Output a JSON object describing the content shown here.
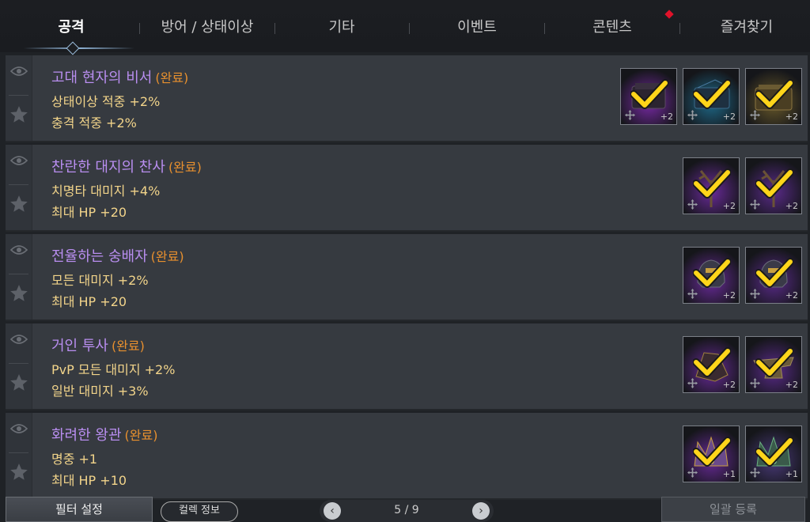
{
  "tabs": [
    {
      "label": "공격",
      "active": true
    },
    {
      "label": "방어 / 상태이상",
      "active": false
    },
    {
      "label": "기타",
      "active": false
    },
    {
      "label": "이벤트",
      "active": false
    },
    {
      "label": "콘텐츠",
      "active": false,
      "has_notification": true
    },
    {
      "label": "즐겨찾기",
      "active": false
    }
  ],
  "rows": [
    {
      "title": "고대 현자의 비서",
      "status": "(완료)",
      "stats": [
        "상태이상 적중 +2%",
        "충격 적중 +2%"
      ],
      "cards": [
        {
          "level": "+2",
          "art": "book-dark",
          "glow": "#7a2aa8"
        },
        {
          "level": "+2",
          "art": "book-blue",
          "glow": "#1e6a8a"
        },
        {
          "level": "+2",
          "art": "book-gold",
          "glow": "#6a5a2a"
        }
      ]
    },
    {
      "title": "찬란한 대지의 찬사",
      "status": "(완료)",
      "stats": [
        "치명타 대미지 +4%",
        "최대 HP +20"
      ],
      "cards": [
        {
          "level": "+2",
          "art": "antler-staff",
          "glow": "#6a2a9a"
        },
        {
          "level": "+2",
          "art": "antler-staff",
          "glow": "#5a2a8a"
        }
      ]
    },
    {
      "title": "전율하는 숭배자",
      "status": "(완료)",
      "stats": [
        "모든 대미지 +2%",
        "최대 HP +20"
      ],
      "cards": [
        {
          "level": "+2",
          "art": "helmet",
          "glow": "#6a2a9a"
        },
        {
          "level": "+2",
          "art": "helmet",
          "glow": "#5a2a8a"
        }
      ]
    },
    {
      "title": "거인 투사",
      "status": "(완료)",
      "stats": [
        "PvP 모든 대미지 +2%",
        "일반 대미지 +3%"
      ],
      "cards": [
        {
          "level": "+2",
          "art": "gauntlet",
          "glow": "#6a2a9a"
        },
        {
          "level": "+2",
          "art": "anvil",
          "glow": "#5a2a8a"
        }
      ]
    },
    {
      "title": "화려한 왕관",
      "status": "(완료)",
      "stats": [
        "명중 +1",
        "최대 HP +10"
      ],
      "cards": [
        {
          "level": "+1",
          "art": "crown-gold",
          "glow": "#6a2a9a"
        },
        {
          "level": "+1",
          "art": "crown-green",
          "glow": "#4a3a7a"
        }
      ]
    }
  ],
  "footer": {
    "filter_label": "필터 설정",
    "collection_label": "컬렉 정보",
    "page_text": "5 / 9",
    "register_label": "일괄 등록"
  },
  "colors": {
    "title": "#b98ef0",
    "status": "#e8902e",
    "stat": "#f2d48a",
    "check": "#ffd51a",
    "notification": "#e0122a"
  }
}
